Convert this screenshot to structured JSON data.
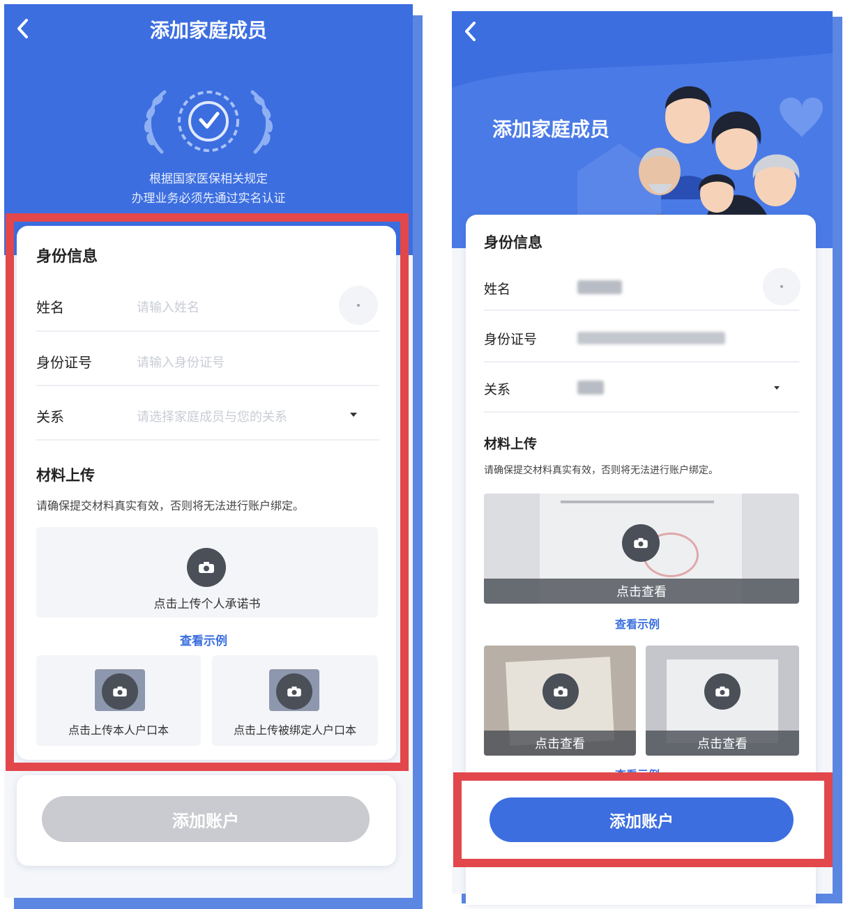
{
  "left": {
    "title": "添加家庭成员",
    "notice_line1": "根据国家医保相关规定",
    "notice_line2": "办理业务必须先通过实名认证",
    "identity_section": "身份信息",
    "fields": [
      {
        "label": "姓名",
        "placeholder": "请输入姓名"
      },
      {
        "label": "身份证号",
        "placeholder": "请输入身份证号"
      },
      {
        "label": "关系",
        "placeholder": "请选择家庭成员与您的关系"
      }
    ],
    "material_section": "材料上传",
    "material_hint": "请确保提交材料真实有效，否则将无法进行账户绑定。",
    "upload_commitment": "点击上传个人承诺书",
    "view_example": "查看示例",
    "upload_own_hukou": "点击上传本人户口本",
    "upload_bound_hukou": "点击上传被绑定人户口本",
    "submit": "添加账户"
  },
  "right": {
    "title": "添加家庭成员",
    "identity_section": "身份信息",
    "fields": [
      {
        "label": "姓名"
      },
      {
        "label": "身份证号"
      },
      {
        "label": "关系"
      }
    ],
    "material_section": "材料上传",
    "material_hint": "请确保提交材料真实有效，否则将无法进行账户绑定。",
    "view_label": "点击查看",
    "view_example": "查看示例",
    "view_example_partial": "查看示例",
    "submit": "添加账户"
  },
  "colors": {
    "brand_blue": "#3c6ee0",
    "highlight_red": "#e2474b",
    "disabled_gray": "#c9cbd0"
  }
}
